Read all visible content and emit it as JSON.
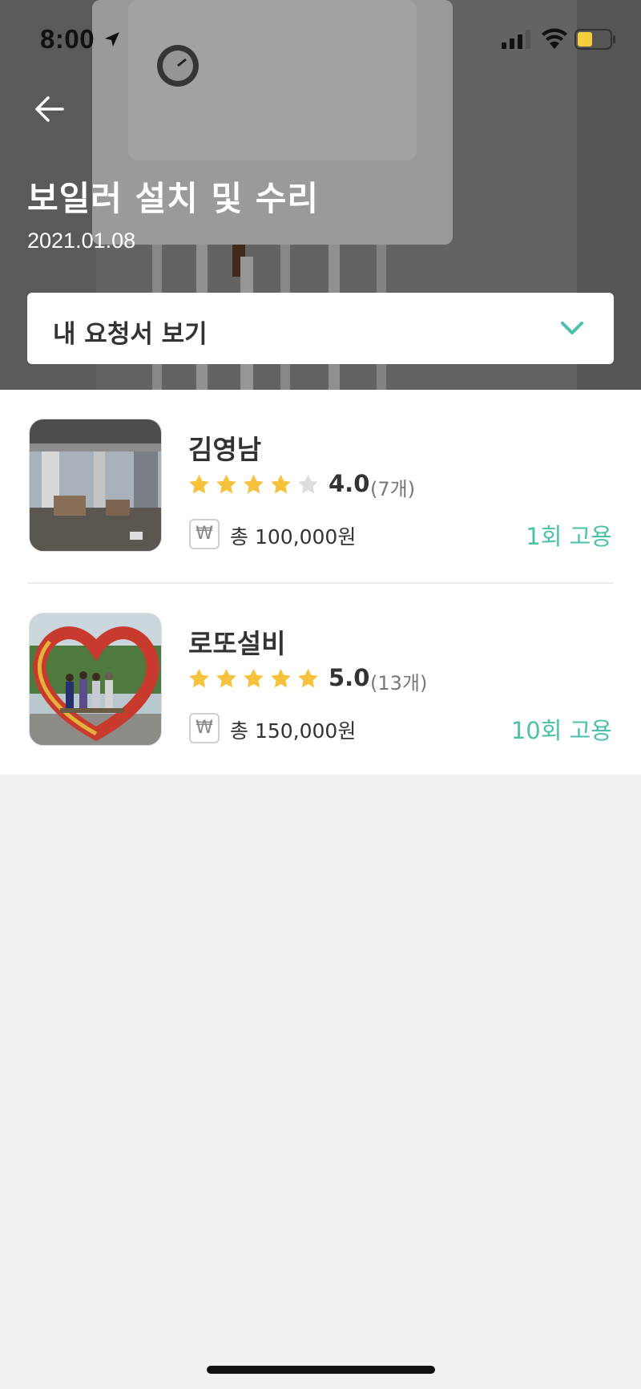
{
  "status_bar": {
    "time": "8:00"
  },
  "header": {
    "title": "보일러 설치 및 수리",
    "date": "2021.01.08",
    "dropdown_label": "내 요청서 보기"
  },
  "providers": [
    {
      "name": "김영남",
      "rating": "4.0",
      "stars_filled": 4,
      "review_count": "(7개)",
      "currency_symbol": "₩",
      "total": "총 100,000원",
      "hires": "1회 고용"
    },
    {
      "name": "로또설비",
      "rating": "5.0",
      "stars_filled": 5,
      "review_count": "(13개)",
      "currency_symbol": "₩",
      "total": "총 150,000원",
      "hires": "10회 고용"
    }
  ],
  "colors": {
    "accent": "#4cc1aa",
    "star": "#f6c23e",
    "star_empty": "#dddddd"
  }
}
